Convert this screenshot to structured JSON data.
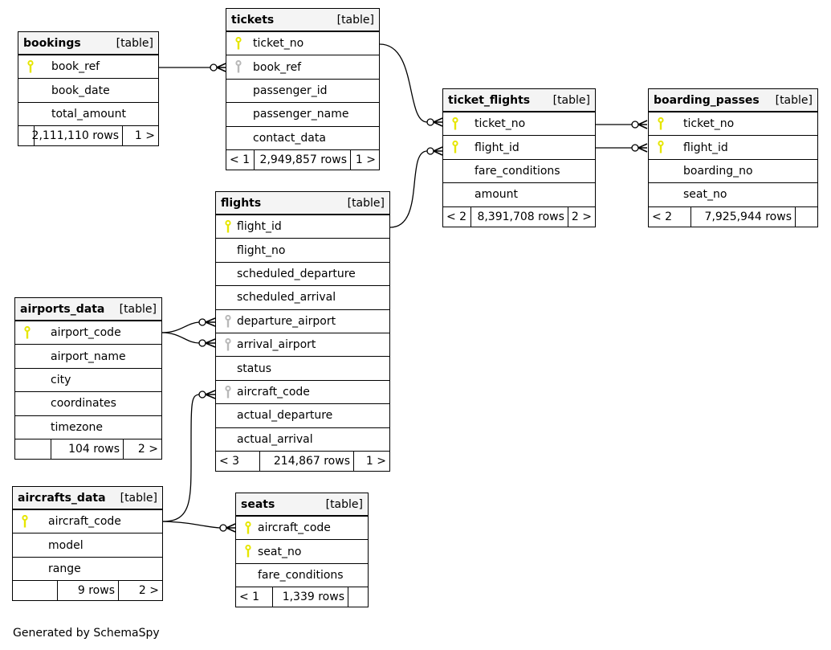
{
  "footer": {
    "generated_by": "Generated by SchemaSpy"
  },
  "colors": {
    "primary_key": "#e6e600",
    "foreign_key": "#b8b8b8",
    "header_bg": "#f4f4f4"
  },
  "tables": {
    "bookings": {
      "name": "bookings",
      "type": "[table]",
      "columns": [
        {
          "name": "book_ref",
          "key": "primary"
        },
        {
          "name": "book_date",
          "key": "none"
        },
        {
          "name": "total_amount",
          "key": "none"
        }
      ],
      "parents": "",
      "rows": "2,111,110 rows",
      "children": "1 >"
    },
    "tickets": {
      "name": "tickets",
      "type": "[table]",
      "columns": [
        {
          "name": "ticket_no",
          "key": "primary"
        },
        {
          "name": "book_ref",
          "key": "foreign"
        },
        {
          "name": "passenger_id",
          "key": "none"
        },
        {
          "name": "passenger_name",
          "key": "none"
        },
        {
          "name": "contact_data",
          "key": "none"
        }
      ],
      "parents": "< 1",
      "rows": "2,949,857 rows",
      "children": "1 >"
    },
    "ticket_flights": {
      "name": "ticket_flights",
      "type": "[table]",
      "columns": [
        {
          "name": "ticket_no",
          "key": "primary"
        },
        {
          "name": "flight_id",
          "key": "primary"
        },
        {
          "name": "fare_conditions",
          "key": "none"
        },
        {
          "name": "amount",
          "key": "none"
        }
      ],
      "parents": "< 2",
      "rows": "8,391,708 rows",
      "children": "2 >"
    },
    "boarding_passes": {
      "name": "boarding_passes",
      "type": "[table]",
      "columns": [
        {
          "name": "ticket_no",
          "key": "primary"
        },
        {
          "name": "flight_id",
          "key": "primary"
        },
        {
          "name": "boarding_no",
          "key": "none"
        },
        {
          "name": "seat_no",
          "key": "none"
        }
      ],
      "parents": "< 2",
      "rows": "7,925,944 rows",
      "children": ""
    },
    "flights": {
      "name": "flights",
      "type": "[table]",
      "columns": [
        {
          "name": "flight_id",
          "key": "primary"
        },
        {
          "name": "flight_no",
          "key": "none"
        },
        {
          "name": "scheduled_departure",
          "key": "none"
        },
        {
          "name": "scheduled_arrival",
          "key": "none"
        },
        {
          "name": "departure_airport",
          "key": "foreign"
        },
        {
          "name": "arrival_airport",
          "key": "foreign"
        },
        {
          "name": "status",
          "key": "none"
        },
        {
          "name": "aircraft_code",
          "key": "foreign"
        },
        {
          "name": "actual_departure",
          "key": "none"
        },
        {
          "name": "actual_arrival",
          "key": "none"
        }
      ],
      "parents": "< 3",
      "rows": "214,867 rows",
      "children": "1 >"
    },
    "airports_data": {
      "name": "airports_data",
      "type": "[table]",
      "columns": [
        {
          "name": "airport_code",
          "key": "primary"
        },
        {
          "name": "airport_name",
          "key": "none"
        },
        {
          "name": "city",
          "key": "none"
        },
        {
          "name": "coordinates",
          "key": "none"
        },
        {
          "name": "timezone",
          "key": "none"
        }
      ],
      "parents": "",
      "rows": "104 rows",
      "children": "2 >"
    },
    "aircrafts_data": {
      "name": "aircrafts_data",
      "type": "[table]",
      "columns": [
        {
          "name": "aircraft_code",
          "key": "primary"
        },
        {
          "name": "model",
          "key": "none"
        },
        {
          "name": "range",
          "key": "none"
        }
      ],
      "parents": "",
      "rows": "9 rows",
      "children": "2 >"
    },
    "seats": {
      "name": "seats",
      "type": "[table]",
      "columns": [
        {
          "name": "aircraft_code",
          "key": "primary"
        },
        {
          "name": "seat_no",
          "key": "primary"
        },
        {
          "name": "fare_conditions",
          "key": "none"
        }
      ],
      "parents": "< 1",
      "rows": "1,339 rows",
      "children": ""
    }
  },
  "relationships": [
    {
      "from": "bookings.book_ref",
      "to": "tickets.book_ref"
    },
    {
      "from": "tickets.ticket_no",
      "to": "ticket_flights.ticket_no"
    },
    {
      "from": "flights.flight_id",
      "to": "ticket_flights.flight_id"
    },
    {
      "from": "ticket_flights.ticket_no",
      "to": "boarding_passes.ticket_no"
    },
    {
      "from": "ticket_flights.flight_id",
      "to": "boarding_passes.flight_id"
    },
    {
      "from": "airports_data.airport_code",
      "to": "flights.departure_airport"
    },
    {
      "from": "airports_data.airport_code",
      "to": "flights.arrival_airport"
    },
    {
      "from": "aircrafts_data.aircraft_code",
      "to": "flights.aircraft_code"
    },
    {
      "from": "aircrafts_data.aircraft_code",
      "to": "seats.aircraft_code"
    }
  ]
}
